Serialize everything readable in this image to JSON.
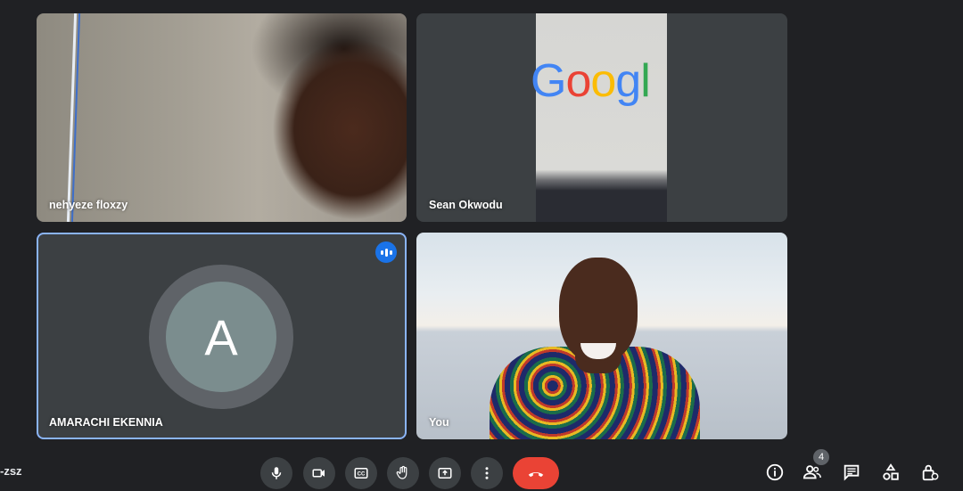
{
  "meeting": {
    "code_fragment": "-zsz"
  },
  "participants": [
    {
      "name": "nehyeze floxzy",
      "type": "video"
    },
    {
      "name": "Sean Okwodu",
      "type": "presentation",
      "screen_logo_text": "Googl"
    },
    {
      "name": "AMARACHI EKENNIA",
      "type": "avatar",
      "avatar_letter": "A",
      "speaking": true
    },
    {
      "name": "You",
      "type": "video"
    }
  ],
  "controls": {
    "buttons": [
      "microphone-icon",
      "camera-icon",
      "captions-icon",
      "raise-hand-icon",
      "present-icon",
      "more-options-icon"
    ],
    "end_call_icon": "phone-hangup-icon"
  },
  "right_controls": {
    "people_count": "4",
    "buttons": [
      "info-icon",
      "people-icon",
      "chat-icon",
      "activities-icon",
      "host-controls-icon"
    ]
  },
  "colors": {
    "background": "#202124",
    "tile": "#3c4043",
    "end_call": "#ea4335",
    "speaking": "#1a73e8",
    "active_border": "#8ab4f8"
  }
}
